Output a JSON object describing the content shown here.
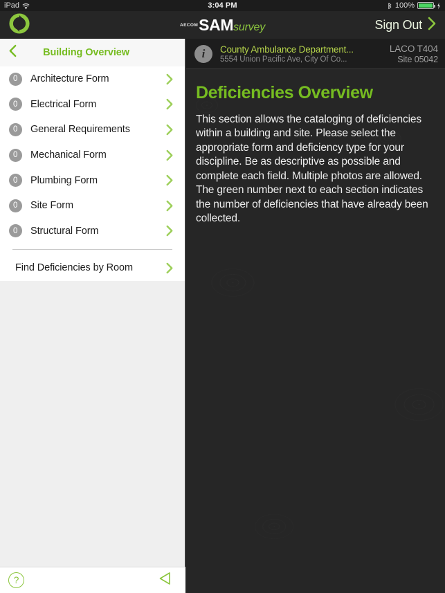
{
  "status_bar": {
    "device": "iPad",
    "wifi_icon": "wifi-icon",
    "time": "3:04 PM",
    "bluetooth_icon": "bluetooth-icon",
    "battery_percent": "100%",
    "battery_icon": "battery-charging-icon"
  },
  "nav": {
    "logo_icon": "aecom-rotation-logo-icon",
    "brand_prefix": "AECOM",
    "brand_name": "SAM",
    "brand_suffix": "survey",
    "sign_out_label": "Sign Out",
    "sign_out_icon": "chevron-right-icon"
  },
  "sidebar": {
    "back_icon": "chevron-left-icon",
    "title": "Building Overview",
    "items": [
      {
        "badge": "0",
        "label": "Architecture Form",
        "chevron": "chevron-right-icon"
      },
      {
        "badge": "0",
        "label": "Electrical Form",
        "chevron": "chevron-right-icon"
      },
      {
        "badge": "0",
        "label": "General Requirements",
        "chevron": "chevron-right-icon"
      },
      {
        "badge": "0",
        "label": "Mechanical Form",
        "chevron": "chevron-right-icon"
      },
      {
        "badge": "0",
        "label": "Plumbing Form",
        "chevron": "chevron-right-icon"
      },
      {
        "badge": "0",
        "label": "Site Form",
        "chevron": "chevron-right-icon"
      },
      {
        "badge": "0",
        "label": "Structural Form",
        "chevron": "chevron-right-icon"
      }
    ],
    "room_search": {
      "label": "Find Deficiencies by Room",
      "chevron": "chevron-right-icon"
    }
  },
  "site_header": {
    "info_icon": "info-circle-icon",
    "info_glyph": "i",
    "name": "County Ambulance Department...",
    "address": "5554 Union Pacific Ave, City Of Co...",
    "code": "LACO T404",
    "site_id": "Site 05042"
  },
  "main": {
    "title": "Deficiencies Overview",
    "paragraph": "This section allows the cataloging of deficiencies within a building and site. Please select the appropriate form and deficiency type for your discipline. Be as descriptive as possible and complete each field. Multiple photos are allowed. The green number next to each section indicates the number of deficiencies that have already been collected."
  },
  "toolbar": {
    "help_icon": "help-circle-icon",
    "help_glyph": "?",
    "prev_icon": "triangle-left-icon"
  },
  "colors": {
    "accent_green": "#76bc21",
    "bright_green": "#8cc63e",
    "site_name_green": "#b5d44b",
    "dark_panel": "#262626",
    "nav_dark": "#262626",
    "status_dark": "#1c1c1c",
    "sidebar_gray": "#efefef",
    "row_white": "#ffffff",
    "badge_gray": "#9a9a9a",
    "battery_green": "#4cd663"
  }
}
